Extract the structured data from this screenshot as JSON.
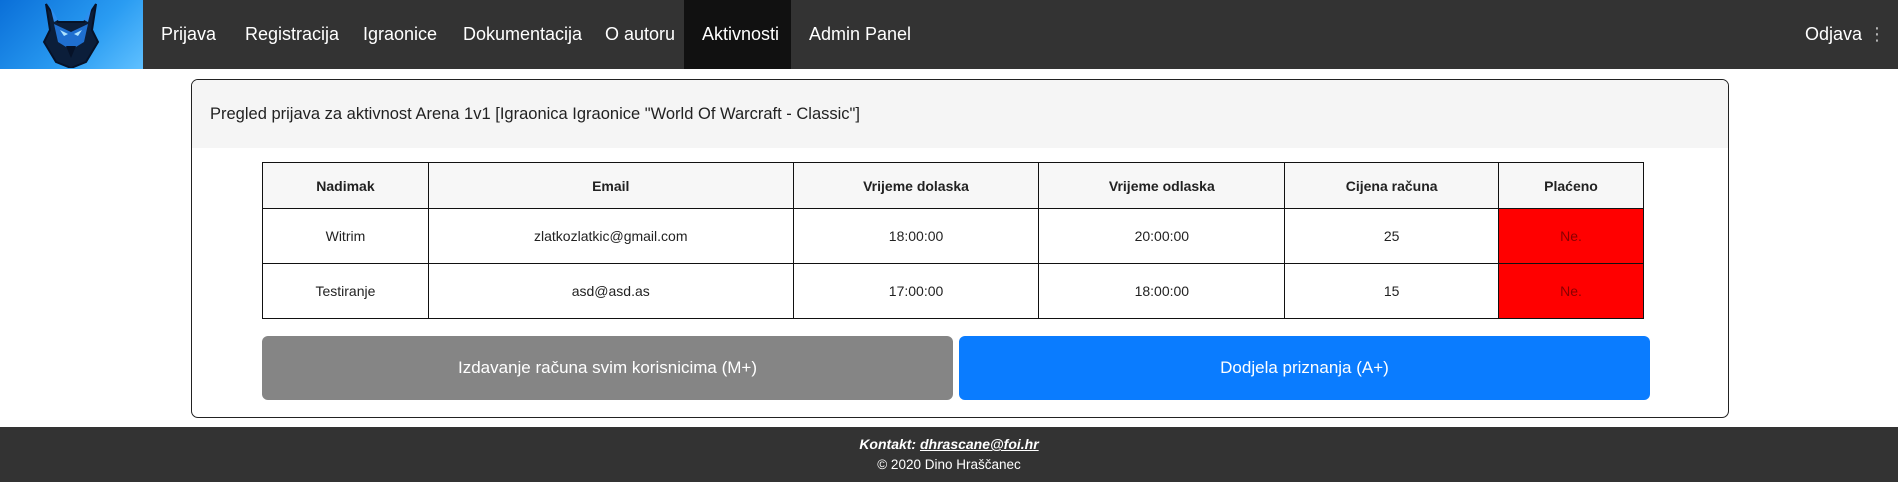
{
  "nav": {
    "items": [
      {
        "label": "Prijava"
      },
      {
        "label": "Registracija"
      },
      {
        "label": "Igraonice"
      },
      {
        "label": "Dokumentacija"
      },
      {
        "label": "O autoru"
      },
      {
        "label": "Aktivnosti"
      },
      {
        "label": "Admin Panel"
      }
    ],
    "active": "Aktivnosti",
    "logout": "Odjava"
  },
  "card": {
    "title": "Pregled prijava za aktivnost Arena 1v1 [Igraonica Igraonice \"World Of Warcraft - Classic\"]"
  },
  "table": {
    "headers": [
      "Nadimak",
      "Email",
      "Vrijeme dolaska",
      "Vrijeme odlaska",
      "Cijena računa",
      "Plaćeno"
    ],
    "rows": [
      [
        "Witrim",
        "zlatkozlatkic@gmail.com",
        "18:00:00",
        "20:00:00",
        "25",
        "Ne."
      ],
      [
        "Testiranje",
        "asd@asd.as",
        "17:00:00",
        "18:00:00",
        "15",
        "Ne."
      ]
    ]
  },
  "buttons": {
    "invoice": "Izdavanje računa svim korisnicima (M+)",
    "award": "Dodjela priznanja (A+)"
  },
  "footer": {
    "contact_label": "Kontakt:",
    "contact_email": "dhrascane@foi.hr",
    "copyright": "© 2020 Dino Hraščanec"
  },
  "colors": {
    "navbar": "#333333",
    "unpaid": "#ff0000",
    "primary": "#0a7cff",
    "secondary": "#858585"
  },
  "icons": {
    "logo": "wolf-logo-icon",
    "menu": "menu-dots-icon"
  }
}
